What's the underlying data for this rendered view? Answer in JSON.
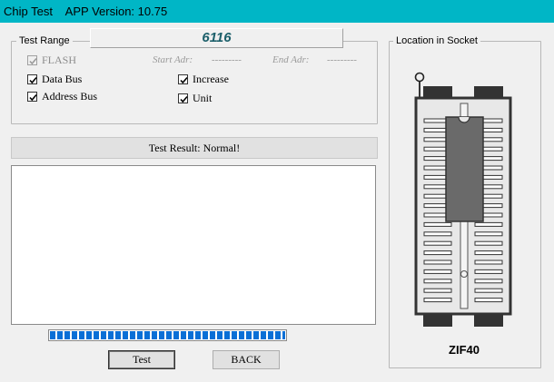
{
  "window": {
    "title": "Chip Test    APP Version: 10.75",
    "titlebar_color": "#00b6c6"
  },
  "test_range": {
    "legend": "Test Range",
    "chip_name": "6116",
    "flash": {
      "label": "FLASH",
      "checked": true,
      "enabled": false
    },
    "start_adr_label": "Start Adr:",
    "start_adr_value": "---------",
    "end_adr_label": "End Adr:",
    "end_adr_value": "---------",
    "options": {
      "data_bus": {
        "label": "Data Bus",
        "checked": true
      },
      "address_bus": {
        "label": "Address Bus",
        "checked": true
      },
      "increase": {
        "label": "Increase",
        "checked": true
      },
      "unit": {
        "label": "Unit",
        "checked": true
      }
    }
  },
  "result": {
    "text": "Test Result: Normal!"
  },
  "log": {
    "text": ""
  },
  "progress": {
    "percent": 100,
    "color": "#0a6fd6"
  },
  "buttons": {
    "test": "Test",
    "back": "BACK"
  },
  "socket": {
    "legend": "Location in Socket",
    "label": "ZIF40",
    "pins_per_side": 20
  }
}
